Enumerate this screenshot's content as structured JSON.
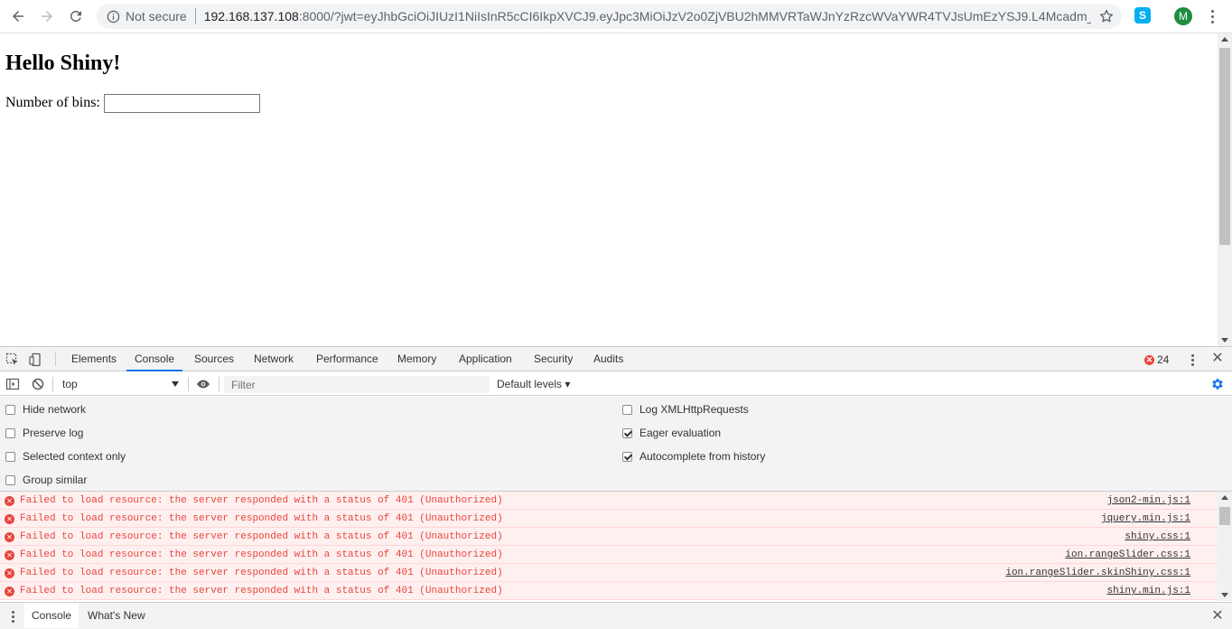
{
  "browser": {
    "security_label": "Not secure",
    "url_host": "192.168.137.108",
    "url_rest": ":8000/?jwt=eyJhbGciOiJIUzI1NiIsInR5cCI6IkpXVCJ9.eyJpc3MiOiJzV2o0ZjVBU2hMMVRTaWJnYzRzcWVaYWR4TVJsUmEzYSJ9.L4Mcadm_VWjEez...",
    "avatar_letter": "M",
    "extension_letter": "S",
    "avatar_color": "#1e8e3e"
  },
  "page": {
    "title": "Hello Shiny!",
    "bins_label": "Number of bins:",
    "bins_value": ""
  },
  "devtools": {
    "tabs": [
      "Elements",
      "Console",
      "Sources",
      "Network",
      "Performance",
      "Memory",
      "Application",
      "Security",
      "Audits"
    ],
    "active_tab": "Console",
    "error_count": "24",
    "context": "top",
    "filter_placeholder": "Filter",
    "levels_label": "Default levels ▾",
    "settings_left": [
      {
        "label": "Hide network",
        "checked": false
      },
      {
        "label": "Preserve log",
        "checked": false
      },
      {
        "label": "Selected context only",
        "checked": false
      },
      {
        "label": "Group similar",
        "checked": false
      }
    ],
    "settings_right": [
      {
        "label": "Log XMLHttpRequests",
        "checked": false
      },
      {
        "label": "Eager evaluation",
        "checked": true
      },
      {
        "label": "Autocomplete from history",
        "checked": true
      }
    ],
    "messages": [
      {
        "text": "Failed to load resource: the server responded with a status of 401 (Unauthorized)",
        "source": "json2-min.js:1"
      },
      {
        "text": "Failed to load resource: the server responded with a status of 401 (Unauthorized)",
        "source": "jquery.min.js:1"
      },
      {
        "text": "Failed to load resource: the server responded with a status of 401 (Unauthorized)",
        "source": "shiny.css:1"
      },
      {
        "text": "Failed to load resource: the server responded with a status of 401 (Unauthorized)",
        "source": "ion.rangeSlider.css:1"
      },
      {
        "text": "Failed to load resource: the server responded with a status of 401 (Unauthorized)",
        "source": "ion.rangeSlider.skinShiny.css:1"
      },
      {
        "text": "Failed to load resource: the server responded with a status of 401 (Unauthorized)",
        "source": "shiny.min.js:1"
      }
    ],
    "drawer_tabs": [
      "Console",
      "What's New"
    ],
    "error_color": "#e8453c",
    "accent_color": "#1a73e8"
  }
}
